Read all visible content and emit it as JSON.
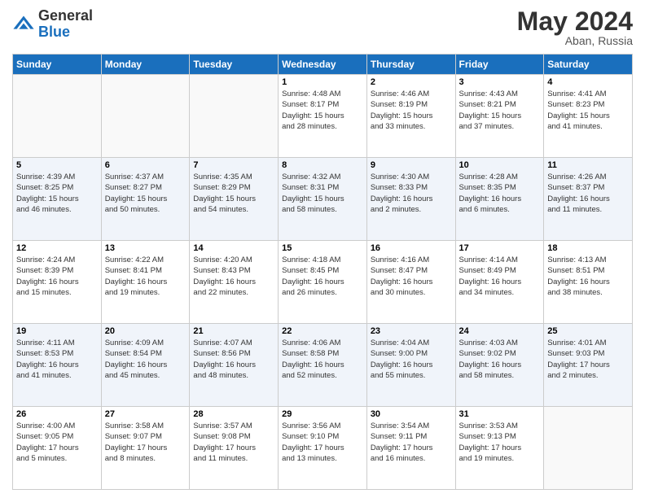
{
  "header": {
    "logo_general": "General",
    "logo_blue": "Blue",
    "month": "May 2024",
    "location": "Aban, Russia"
  },
  "days_of_week": [
    "Sunday",
    "Monday",
    "Tuesday",
    "Wednesday",
    "Thursday",
    "Friday",
    "Saturday"
  ],
  "weeks": [
    [
      {
        "day": "",
        "info": ""
      },
      {
        "day": "",
        "info": ""
      },
      {
        "day": "",
        "info": ""
      },
      {
        "day": "1",
        "info": "Sunrise: 4:48 AM\nSunset: 8:17 PM\nDaylight: 15 hours\nand 28 minutes."
      },
      {
        "day": "2",
        "info": "Sunrise: 4:46 AM\nSunset: 8:19 PM\nDaylight: 15 hours\nand 33 minutes."
      },
      {
        "day": "3",
        "info": "Sunrise: 4:43 AM\nSunset: 8:21 PM\nDaylight: 15 hours\nand 37 minutes."
      },
      {
        "day": "4",
        "info": "Sunrise: 4:41 AM\nSunset: 8:23 PM\nDaylight: 15 hours\nand 41 minutes."
      }
    ],
    [
      {
        "day": "5",
        "info": "Sunrise: 4:39 AM\nSunset: 8:25 PM\nDaylight: 15 hours\nand 46 minutes."
      },
      {
        "day": "6",
        "info": "Sunrise: 4:37 AM\nSunset: 8:27 PM\nDaylight: 15 hours\nand 50 minutes."
      },
      {
        "day": "7",
        "info": "Sunrise: 4:35 AM\nSunset: 8:29 PM\nDaylight: 15 hours\nand 54 minutes."
      },
      {
        "day": "8",
        "info": "Sunrise: 4:32 AM\nSunset: 8:31 PM\nDaylight: 15 hours\nand 58 minutes."
      },
      {
        "day": "9",
        "info": "Sunrise: 4:30 AM\nSunset: 8:33 PM\nDaylight: 16 hours\nand 2 minutes."
      },
      {
        "day": "10",
        "info": "Sunrise: 4:28 AM\nSunset: 8:35 PM\nDaylight: 16 hours\nand 6 minutes."
      },
      {
        "day": "11",
        "info": "Sunrise: 4:26 AM\nSunset: 8:37 PM\nDaylight: 16 hours\nand 11 minutes."
      }
    ],
    [
      {
        "day": "12",
        "info": "Sunrise: 4:24 AM\nSunset: 8:39 PM\nDaylight: 16 hours\nand 15 minutes."
      },
      {
        "day": "13",
        "info": "Sunrise: 4:22 AM\nSunset: 8:41 PM\nDaylight: 16 hours\nand 19 minutes."
      },
      {
        "day": "14",
        "info": "Sunrise: 4:20 AM\nSunset: 8:43 PM\nDaylight: 16 hours\nand 22 minutes."
      },
      {
        "day": "15",
        "info": "Sunrise: 4:18 AM\nSunset: 8:45 PM\nDaylight: 16 hours\nand 26 minutes."
      },
      {
        "day": "16",
        "info": "Sunrise: 4:16 AM\nSunset: 8:47 PM\nDaylight: 16 hours\nand 30 minutes."
      },
      {
        "day": "17",
        "info": "Sunrise: 4:14 AM\nSunset: 8:49 PM\nDaylight: 16 hours\nand 34 minutes."
      },
      {
        "day": "18",
        "info": "Sunrise: 4:13 AM\nSunset: 8:51 PM\nDaylight: 16 hours\nand 38 minutes."
      }
    ],
    [
      {
        "day": "19",
        "info": "Sunrise: 4:11 AM\nSunset: 8:53 PM\nDaylight: 16 hours\nand 41 minutes."
      },
      {
        "day": "20",
        "info": "Sunrise: 4:09 AM\nSunset: 8:54 PM\nDaylight: 16 hours\nand 45 minutes."
      },
      {
        "day": "21",
        "info": "Sunrise: 4:07 AM\nSunset: 8:56 PM\nDaylight: 16 hours\nand 48 minutes."
      },
      {
        "day": "22",
        "info": "Sunrise: 4:06 AM\nSunset: 8:58 PM\nDaylight: 16 hours\nand 52 minutes."
      },
      {
        "day": "23",
        "info": "Sunrise: 4:04 AM\nSunset: 9:00 PM\nDaylight: 16 hours\nand 55 minutes."
      },
      {
        "day": "24",
        "info": "Sunrise: 4:03 AM\nSunset: 9:02 PM\nDaylight: 16 hours\nand 58 minutes."
      },
      {
        "day": "25",
        "info": "Sunrise: 4:01 AM\nSunset: 9:03 PM\nDaylight: 17 hours\nand 2 minutes."
      }
    ],
    [
      {
        "day": "26",
        "info": "Sunrise: 4:00 AM\nSunset: 9:05 PM\nDaylight: 17 hours\nand 5 minutes."
      },
      {
        "day": "27",
        "info": "Sunrise: 3:58 AM\nSunset: 9:07 PM\nDaylight: 17 hours\nand 8 minutes."
      },
      {
        "day": "28",
        "info": "Sunrise: 3:57 AM\nSunset: 9:08 PM\nDaylight: 17 hours\nand 11 minutes."
      },
      {
        "day": "29",
        "info": "Sunrise: 3:56 AM\nSunset: 9:10 PM\nDaylight: 17 hours\nand 13 minutes."
      },
      {
        "day": "30",
        "info": "Sunrise: 3:54 AM\nSunset: 9:11 PM\nDaylight: 17 hours\nand 16 minutes."
      },
      {
        "day": "31",
        "info": "Sunrise: 3:53 AM\nSunset: 9:13 PM\nDaylight: 17 hours\nand 19 minutes."
      },
      {
        "day": "",
        "info": ""
      }
    ]
  ]
}
